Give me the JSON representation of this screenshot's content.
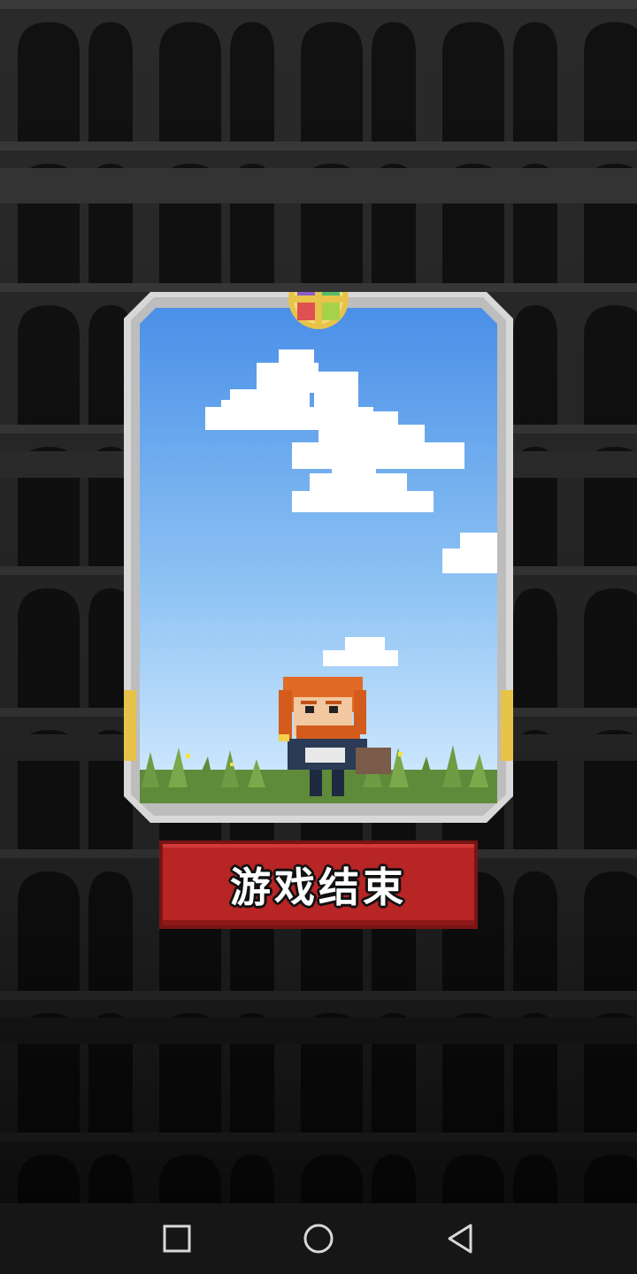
{
  "game": {
    "end_button_label": "游戏结束"
  },
  "icons": {
    "emblem": "four-color-cross-emblem",
    "hero": "bearded-warrior-sprite",
    "nav_recent": "square-icon",
    "nav_home": "circle-icon",
    "nav_back": "triangle-back-icon"
  },
  "colors": {
    "sky_top": "#4a8fe8",
    "sky_bottom": "#d6ecff",
    "button_red": "#b82525",
    "frame_silver": "#d8d8d8",
    "gold": "#e8c34a"
  }
}
